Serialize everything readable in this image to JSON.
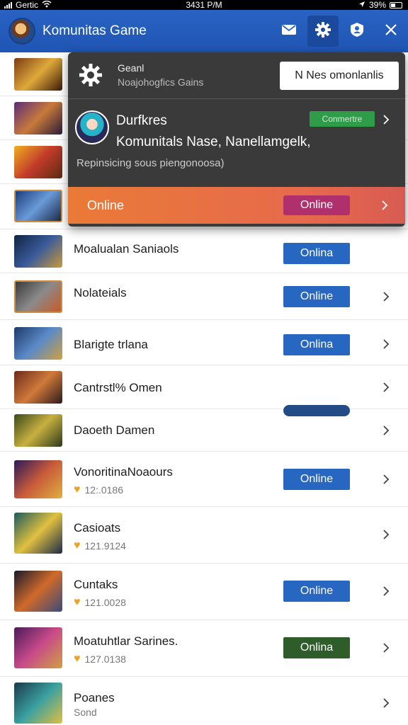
{
  "status_bar": {
    "carrier": "Gertic",
    "time": "3431 P/M",
    "battery": "39%"
  },
  "header": {
    "title": "Komunitas Game"
  },
  "popup": {
    "setting_title": "Geanl",
    "setting_subtitle": "Noajohogfics Gains",
    "notify_button": "N Nes omonlanlis",
    "profile_name": "Durfkres",
    "community_badge": "Conmertre",
    "profile_description": "Komunitals Nase, Nanellamgelk,",
    "profile_subtitle": "Repinsicing sous piengonoosa)",
    "online_label": "Online",
    "online_button": "Online"
  },
  "rows": [
    {
      "title": "Moalualan Saniaols",
      "status": "Onlina",
      "style": "blue"
    },
    {
      "title": "Nolateials",
      "status": "Online",
      "style": "blue"
    },
    {
      "title": "Blarigte trlana",
      "status": "Onlina",
      "style": "blue"
    },
    {
      "title": "Cantrstl% Omen",
      "status": "",
      "style": "none"
    },
    {
      "title": "Daoeth Damen",
      "status": "",
      "style": "empty"
    },
    {
      "title": "VonoritinaNoaours",
      "sub": "12:.0186",
      "status": "Online",
      "style": "blue"
    },
    {
      "title": "Casioats",
      "sub": "121.9124",
      "status": "",
      "style": "none"
    },
    {
      "title": "Cuntaks",
      "sub": "121.0028",
      "status": "Online",
      "style": "blue"
    },
    {
      "title": "Moatuhtlar Sarines.",
      "sub": "127.0138",
      "status": "Onlina",
      "style": "green"
    },
    {
      "title": "Poanes",
      "sub": "Sond",
      "status": "",
      "style": "none"
    }
  ],
  "colors": {
    "header_blue": "#2a63c4",
    "button_blue": "#2767c1",
    "popup_orange": "#ea7a37",
    "popup_magenta": "#b0306d",
    "badge_green": "#2f9c4a"
  }
}
